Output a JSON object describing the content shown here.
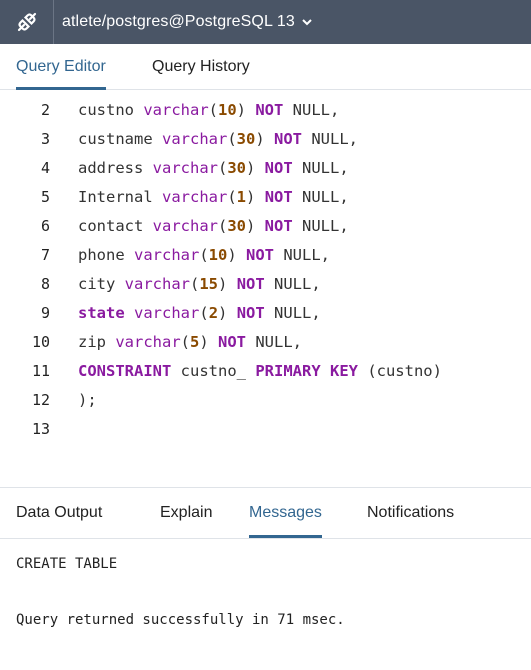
{
  "titlebar": {
    "icon": "connection-status-icon",
    "connection_label": "atlete/postgres@PostgreSQL 13",
    "dropdown_icon": "chevron-down-icon"
  },
  "editor_tabs": [
    "Query Editor",
    "Query History"
  ],
  "editor_active_tab": "Query Editor",
  "editor": {
    "lines": [
      {
        "num": "2",
        "tokens": [
          {
            "t": "custno ",
            "c": "pl"
          },
          {
            "t": "varchar",
            "c": "ty"
          },
          {
            "t": "(",
            "c": "pl"
          },
          {
            "t": "10",
            "c": "nm"
          },
          {
            "t": ") ",
            "c": "pl"
          },
          {
            "t": "NOT",
            "c": "kw"
          },
          {
            "t": " NULL,",
            "c": "pl"
          }
        ]
      },
      {
        "num": "3",
        "tokens": [
          {
            "t": "custname ",
            "c": "pl"
          },
          {
            "t": "varchar",
            "c": "ty"
          },
          {
            "t": "(",
            "c": "pl"
          },
          {
            "t": "30",
            "c": "nm"
          },
          {
            "t": ") ",
            "c": "pl"
          },
          {
            "t": "NOT",
            "c": "kw"
          },
          {
            "t": " NULL,",
            "c": "pl"
          }
        ]
      },
      {
        "num": "4",
        "tokens": [
          {
            "t": "address ",
            "c": "pl"
          },
          {
            "t": "varchar",
            "c": "ty"
          },
          {
            "t": "(",
            "c": "pl"
          },
          {
            "t": "30",
            "c": "nm"
          },
          {
            "t": ") ",
            "c": "pl"
          },
          {
            "t": "NOT",
            "c": "kw"
          },
          {
            "t": " NULL,",
            "c": "pl"
          }
        ]
      },
      {
        "num": "5",
        "tokens": [
          {
            "t": "Internal ",
            "c": "pl"
          },
          {
            "t": "varchar",
            "c": "ty"
          },
          {
            "t": "(",
            "c": "pl"
          },
          {
            "t": "1",
            "c": "nm"
          },
          {
            "t": ") ",
            "c": "pl"
          },
          {
            "t": "NOT",
            "c": "kw"
          },
          {
            "t": " NULL,",
            "c": "pl"
          }
        ]
      },
      {
        "num": "6",
        "tokens": [
          {
            "t": "contact ",
            "c": "pl"
          },
          {
            "t": "varchar",
            "c": "ty"
          },
          {
            "t": "(",
            "c": "pl"
          },
          {
            "t": "30",
            "c": "nm"
          },
          {
            "t": ") ",
            "c": "pl"
          },
          {
            "t": "NOT",
            "c": "kw"
          },
          {
            "t": " NULL,",
            "c": "pl"
          }
        ]
      },
      {
        "num": "7",
        "tokens": [
          {
            "t": "phone ",
            "c": "pl"
          },
          {
            "t": "varchar",
            "c": "ty"
          },
          {
            "t": "(",
            "c": "pl"
          },
          {
            "t": "10",
            "c": "nm"
          },
          {
            "t": ") ",
            "c": "pl"
          },
          {
            "t": "NOT",
            "c": "kw"
          },
          {
            "t": " NULL,",
            "c": "pl"
          }
        ]
      },
      {
        "num": "8",
        "tokens": [
          {
            "t": "city ",
            "c": "pl"
          },
          {
            "t": "varchar",
            "c": "ty"
          },
          {
            "t": "(",
            "c": "pl"
          },
          {
            "t": "15",
            "c": "nm"
          },
          {
            "t": ") ",
            "c": "pl"
          },
          {
            "t": "NOT",
            "c": "kw"
          },
          {
            "t": " NULL,",
            "c": "pl"
          }
        ]
      },
      {
        "num": "9",
        "tokens": [
          {
            "t": "state",
            "c": "kw"
          },
          {
            "t": " ",
            "c": "pl"
          },
          {
            "t": "varchar",
            "c": "ty"
          },
          {
            "t": "(",
            "c": "pl"
          },
          {
            "t": "2",
            "c": "nm"
          },
          {
            "t": ") ",
            "c": "pl"
          },
          {
            "t": "NOT",
            "c": "kw"
          },
          {
            "t": " NULL,",
            "c": "pl"
          }
        ]
      },
      {
        "num": "10",
        "tokens": [
          {
            "t": "zip ",
            "c": "pl"
          },
          {
            "t": "varchar",
            "c": "ty"
          },
          {
            "t": "(",
            "c": "pl"
          },
          {
            "t": "5",
            "c": "nm"
          },
          {
            "t": ") ",
            "c": "pl"
          },
          {
            "t": "NOT",
            "c": "kw"
          },
          {
            "t": " NULL,",
            "c": "pl"
          }
        ]
      },
      {
        "num": "11",
        "tokens": [
          {
            "t": "CONSTRAINT",
            "c": "kw"
          },
          {
            "t": " custno_ ",
            "c": "pl"
          },
          {
            "t": "PRIMARY KEY",
            "c": "kw"
          },
          {
            "t": " (custno)",
            "c": "pl"
          }
        ]
      },
      {
        "num": "12",
        "tokens": [
          {
            "t": ");",
            "c": "pl"
          }
        ]
      },
      {
        "num": "13",
        "tokens": []
      }
    ]
  },
  "output_tabs": [
    "Data Output",
    "Explain",
    "Messages",
    "Notifications"
  ],
  "output_active_tab": "Messages",
  "messages": {
    "line1": "CREATE TABLE",
    "line2": "Query returned successfully in 71 msec."
  },
  "colors": {
    "titlebar_bg": "#4a5566",
    "accent": "#326690",
    "keyword": "#8a1aa0",
    "number": "#8a4a00"
  }
}
